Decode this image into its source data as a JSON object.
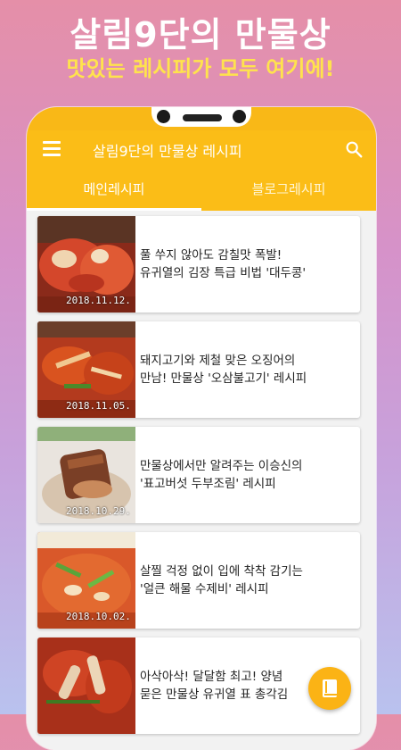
{
  "promo": {
    "title": "살림9단의 만물상",
    "subtitle": "맛있는 레시피가 모두 여기에!"
  },
  "app": {
    "title": "살림9단의 만물상 레시피",
    "accent_color": "#fbbd17",
    "menu_icon": "hamburger-menu-icon",
    "search_icon": "search-icon"
  },
  "tabs": [
    {
      "label": "메인레시피",
      "active": true
    },
    {
      "label": "블로그레시피",
      "active": false
    }
  ],
  "recipes": [
    {
      "date": "2018.11.12.",
      "title": "풀 쑤지 않아도 감칠맛 폭발!\n유귀열의 김장 특급 비법 '대두콩'"
    },
    {
      "date": "2018.11.05.",
      "title": "돼지고기와 제철 맞은 오징어의\n만남! 만물상 '오삼불고기' 레시피"
    },
    {
      "date": "2018.10.29.",
      "title": "만물상에서만 알려주는 이승신의\n'표고버섯 두부조림' 레시피"
    },
    {
      "date": "2018.10.02.",
      "title": "살찔 걱정 없이 입에 착착 감기는\n'얼큰 해물 수제비' 레시피"
    },
    {
      "date": "",
      "title": "아삭아삭! 달달함 최고! 양념\n묻은 만물상 유귀열 표 총각김"
    }
  ],
  "fab": {
    "icon": "book-icon"
  }
}
